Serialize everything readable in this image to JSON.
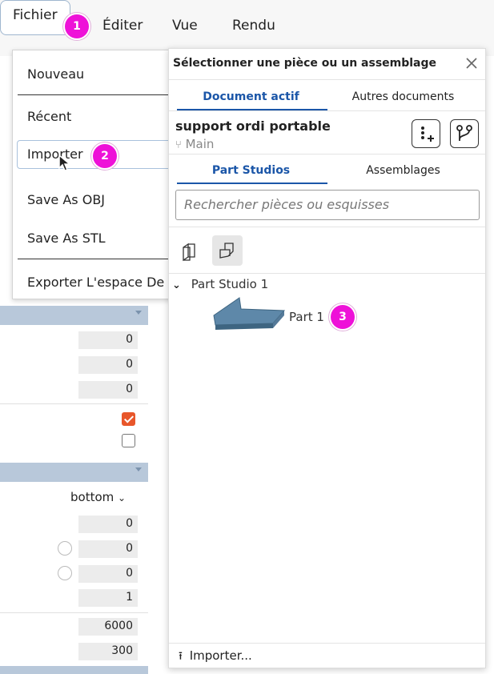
{
  "menubar": {
    "items": [
      "Fichier",
      "Éditer",
      "Vue",
      "Rendu"
    ]
  },
  "dropdown": {
    "items": [
      "Nouveau",
      "Récent",
      "Importer",
      "Save As OBJ",
      "Save As STL",
      "Exporter L'espace De"
    ]
  },
  "badges": [
    "1",
    "2",
    "3"
  ],
  "left_panel": {
    "fields_a": [
      "0",
      "0",
      "0"
    ],
    "checkboxes": [
      true,
      false
    ],
    "select_value": "bottom",
    "fields_b": [
      "0",
      "0",
      "0",
      "1"
    ],
    "fields_c": [
      "6000",
      "300"
    ]
  },
  "panel": {
    "title": "Sélectionner une pièce ou un assemblage",
    "close_icon": "close-icon",
    "doc_tabs": [
      "Document actif",
      "Autres documents"
    ],
    "document_name": "support ordi portable",
    "branch": "Main",
    "type_tabs": [
      "Part Studios",
      "Assemblages"
    ],
    "search_placeholder": "Rechercher pièces ou esquisses",
    "tree_root": "Part Studio 1",
    "part_name": "Part 1",
    "import_label": "Importer..."
  },
  "colors": {
    "accent": "#1b56a8",
    "badge": "#ee11d8",
    "checkbox_on": "#e8562a",
    "left_bar": "#b8c8da"
  }
}
